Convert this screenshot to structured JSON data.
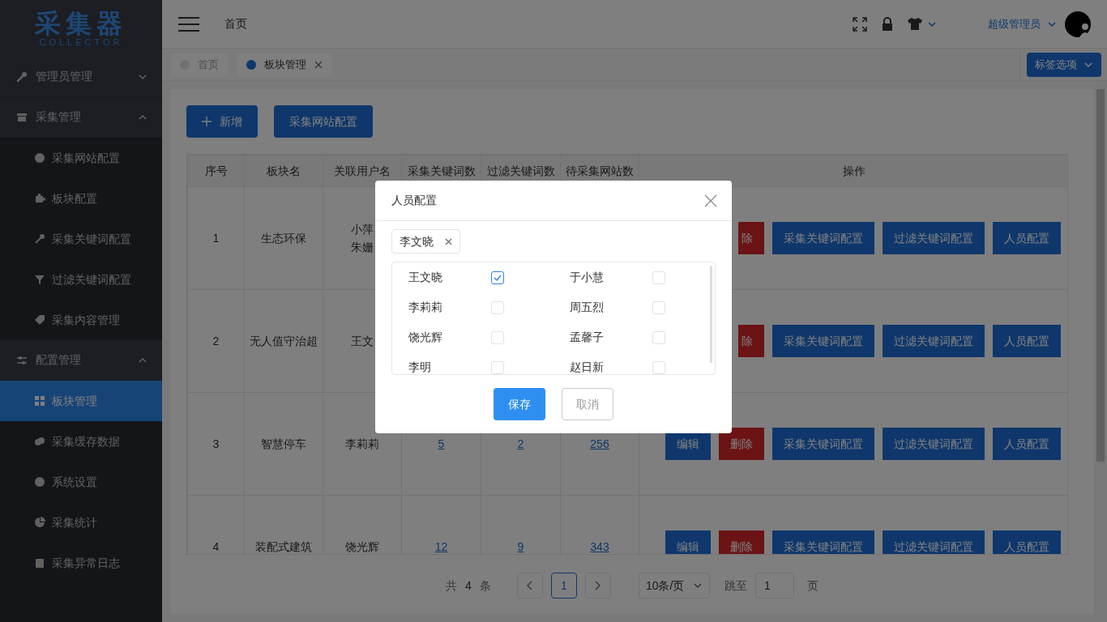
{
  "logo": {
    "title": "采集器",
    "subtitle": "COLLECTOR"
  },
  "sidebar": {
    "items": [
      {
        "label": "管理员管理",
        "expanded": false,
        "selected": false
      },
      {
        "label": "采集管理",
        "expanded": true,
        "selected": false,
        "children": [
          {
            "label": "采集网站配置",
            "selected": false
          },
          {
            "label": "板块配置",
            "selected": false
          },
          {
            "label": "采集关键词配置",
            "selected": false
          },
          {
            "label": "过滤关键词配置",
            "selected": false
          },
          {
            "label": "采集内容管理",
            "selected": false
          }
        ]
      },
      {
        "label": "配置管理",
        "expanded": true,
        "selected": false,
        "children": [
          {
            "label": "板块管理",
            "selected": true
          },
          {
            "label": "采集缓存数据",
            "selected": false
          },
          {
            "label": "系统设置",
            "selected": false
          },
          {
            "label": "采集统计",
            "selected": false
          },
          {
            "label": "采集异常日志",
            "selected": false
          }
        ]
      }
    ]
  },
  "header": {
    "breadcrumb": "首页",
    "user": "超级管理员"
  },
  "tabs": [
    {
      "label": "首页",
      "selected": false,
      "closable": false
    },
    {
      "label": "板块管理",
      "selected": true,
      "closable": true
    }
  ],
  "tab_options": "标签选项",
  "toolbar": [
    {
      "label": "新增",
      "kind": "add"
    },
    {
      "label": "采集网站配置",
      "kind": "plain"
    }
  ],
  "table": {
    "columns": [
      "序号",
      "板块名",
      "关联用户名",
      "采集关键词数",
      "过滤关键词数",
      "待采集网站数",
      "操作"
    ],
    "rows": [
      {
        "index": "1",
        "name": "生态环保",
        "users": [
          "小萍",
          "朱姗"
        ],
        "actions": [
          {
            "label": "除",
            "kind": "delete"
          },
          {
            "label": "采集关键词配置",
            "kind": "primary"
          },
          {
            "label": "过滤关键词配置",
            "kind": "primary"
          },
          {
            "label": "人员配置",
            "kind": "primary"
          }
        ]
      },
      {
        "index": "2",
        "name": "无人值守治超",
        "users": [
          "王文"
        ],
        "actions": [
          {
            "label": "除",
            "kind": "delete"
          },
          {
            "label": "采集关键词配置",
            "kind": "primary"
          },
          {
            "label": "过滤关键词配置",
            "kind": "primary"
          },
          {
            "label": "人员配置",
            "kind": "primary"
          }
        ]
      },
      {
        "index": "3",
        "name": "智慧停车",
        "users": [
          "李莉莉"
        ],
        "keyword_count": "5",
        "filter_count": "2",
        "site_count": "256",
        "actions": [
          {
            "label": "编辑",
            "kind": "primary"
          },
          {
            "label": "删除",
            "kind": "delete"
          },
          {
            "label": "采集关键词配置",
            "kind": "primary"
          },
          {
            "label": "过滤关键词配置",
            "kind": "primary"
          },
          {
            "label": "人员配置",
            "kind": "primary"
          }
        ]
      },
      {
        "index": "4",
        "name": "装配式建筑",
        "users": [
          "饶光辉"
        ],
        "keyword_count": "12",
        "filter_count": "9",
        "site_count": "343",
        "actions": [
          {
            "label": "编辑",
            "kind": "primary"
          },
          {
            "label": "删除",
            "kind": "delete"
          },
          {
            "label": "采集关键词配置",
            "kind": "primary"
          },
          {
            "label": "过滤关键词配置",
            "kind": "primary"
          },
          {
            "label": "人员配置",
            "kind": "primary"
          }
        ]
      }
    ]
  },
  "pagination": {
    "total_prefix": "共",
    "total": "4",
    "total_suffix": "条",
    "pages": [
      {
        "label": "1",
        "selected": true
      }
    ],
    "page_size": "10条/页",
    "jump_label": "跳至",
    "jump_value": "1",
    "jump_suffix": "页"
  },
  "modal": {
    "title": "人员配置",
    "selected_tags": [
      "李文晓"
    ],
    "people": [
      {
        "name": "王文晓",
        "checked": true
      },
      {
        "name": "于小慧",
        "checked": false
      },
      {
        "name": "李莉莉",
        "checked": false
      },
      {
        "name": "周五烈",
        "checked": false
      },
      {
        "name": "饶光辉",
        "checked": false
      },
      {
        "name": "孟馨子",
        "checked": false
      },
      {
        "name": "李明",
        "checked": false
      },
      {
        "name": "赵日新",
        "checked": false
      }
    ],
    "buttons": [
      {
        "label": "保存",
        "kind": "primary"
      },
      {
        "label": "取消",
        "kind": "plain"
      }
    ]
  }
}
